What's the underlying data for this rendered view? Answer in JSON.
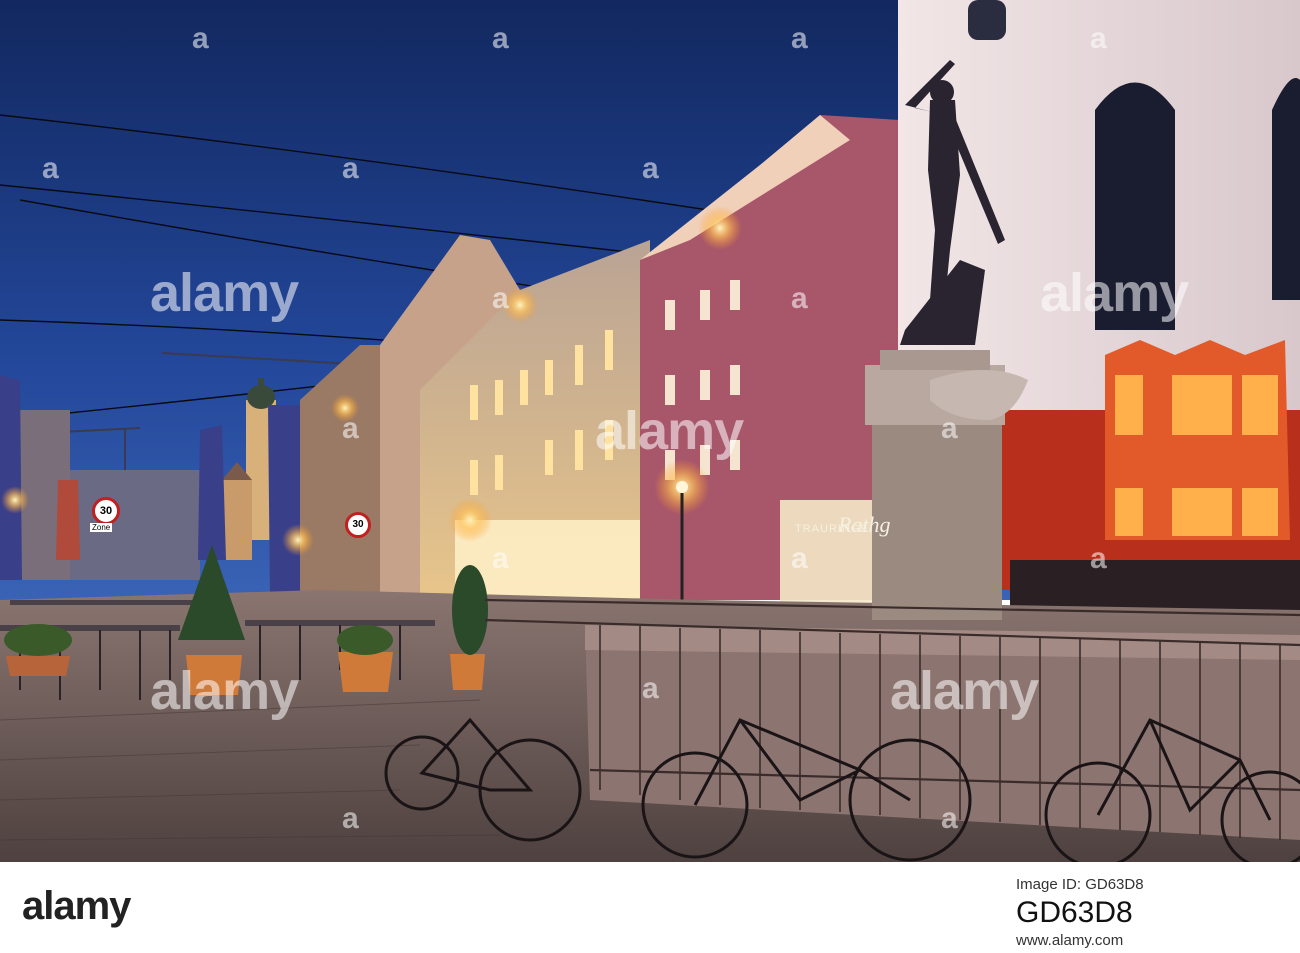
{
  "photo": {
    "description_icons": [
      "mercury-statue",
      "fountain",
      "bicycle",
      "street-lamp",
      "church-tower"
    ],
    "colors": {
      "sky_top": "#14306e",
      "sky_bottom": "#2d55a8",
      "lamp": "#ffd68a",
      "pavement": "#6b5a55"
    }
  },
  "watermarks": {
    "label": "alamy",
    "small_label": "a"
  },
  "signs": {
    "shop_1": "TRAURINGE",
    "shop_2": "Rathg",
    "speed_1": "30",
    "speed_2": "30",
    "zone": "Zone"
  },
  "footer": {
    "logo": "alamy",
    "image_id_label": "Image ID: GD63D8",
    "image_id": "GD63D8",
    "website": "www.alamy.com"
  }
}
